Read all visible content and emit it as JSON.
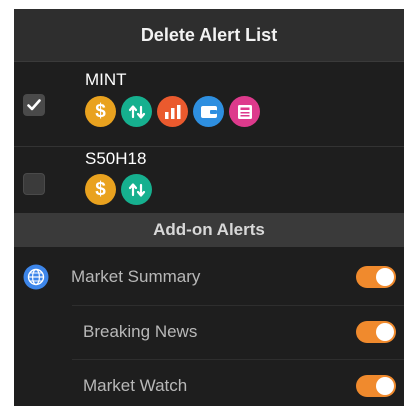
{
  "header": {
    "title": "Delete Alert List"
  },
  "alerts": [
    {
      "symbol": "MINT",
      "checked": true,
      "icons": [
        "dollar-icon",
        "price-change-icon",
        "chart-icon",
        "wallet-icon",
        "news-icon"
      ]
    },
    {
      "symbol": "S50H18",
      "checked": false,
      "icons": [
        "dollar-icon",
        "price-change-icon"
      ]
    }
  ],
  "addons": {
    "title": "Add-on Alerts",
    "items": [
      {
        "label": "Market Summary",
        "enabled": true,
        "icon": "globe-icon"
      },
      {
        "label": "Breaking News",
        "enabled": true
      },
      {
        "label": "Market Watch",
        "enabled": true
      }
    ]
  },
  "colors": {
    "toggle_on": "#f08a2d",
    "dollar": "#e9a21f",
    "price_change": "#16b08f",
    "chart": "#ea5a2e",
    "wallet": "#2e8fe0",
    "news": "#dd3a8c",
    "globe": "#3d86ea"
  }
}
